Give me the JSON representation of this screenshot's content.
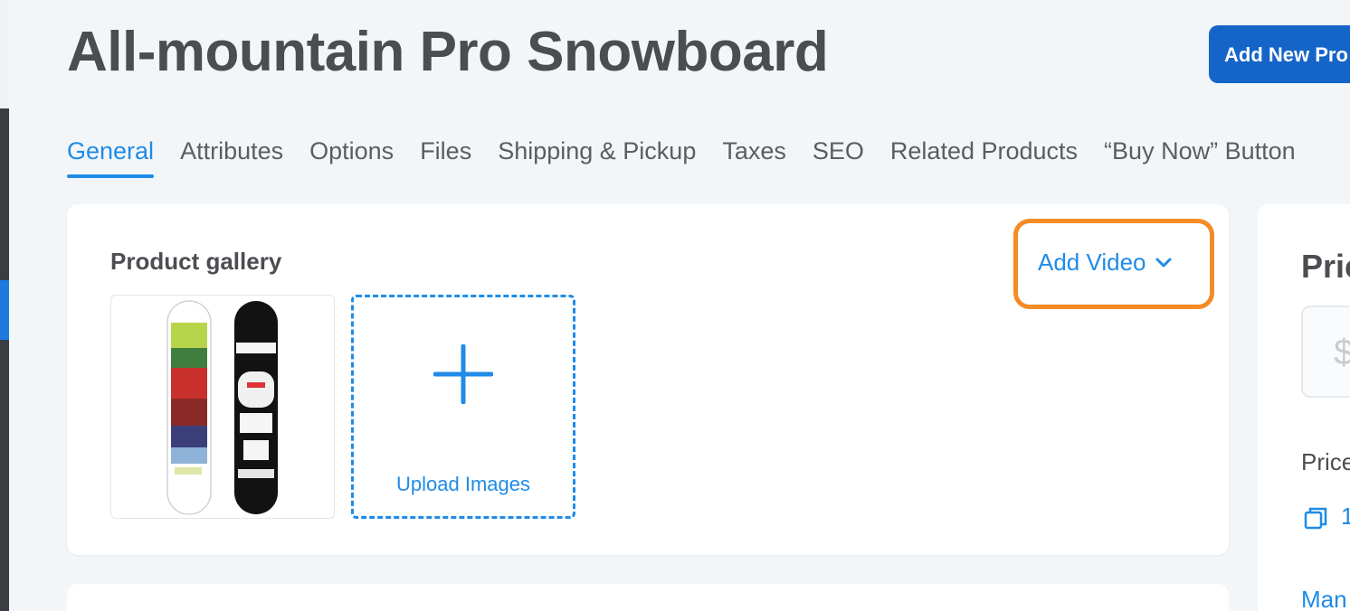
{
  "page": {
    "title": "All-mountain Pro Snowboard",
    "add_product_button": "Add New Pro"
  },
  "tabs": [
    {
      "label": "General",
      "active": true
    },
    {
      "label": "Attributes"
    },
    {
      "label": "Options"
    },
    {
      "label": "Files"
    },
    {
      "label": "Shipping & Pickup"
    },
    {
      "label": "Taxes"
    },
    {
      "label": "SEO"
    },
    {
      "label": "Related Products"
    },
    {
      "label": "“Buy Now” Button"
    }
  ],
  "gallery": {
    "label": "Product gallery",
    "add_video_label": "Add Video",
    "upload_label": "Upload Images",
    "highlight_color": "#f58b24"
  },
  "pricing": {
    "title": "Pric",
    "currency_symbol": "$",
    "price_label": "Price",
    "copy_value": "1",
    "manage_link": "Man"
  },
  "colors": {
    "accent": "#1f8be6",
    "button": "#1565c9"
  }
}
